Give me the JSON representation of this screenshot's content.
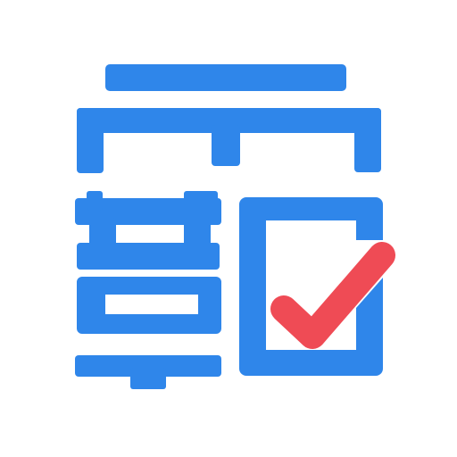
{
  "logo": {
    "icon_name": "form-check-logo-icon",
    "colors": {
      "primary_blue": "#2f86ea",
      "check_red": "#ef4b55",
      "background": "#ffffff"
    }
  }
}
